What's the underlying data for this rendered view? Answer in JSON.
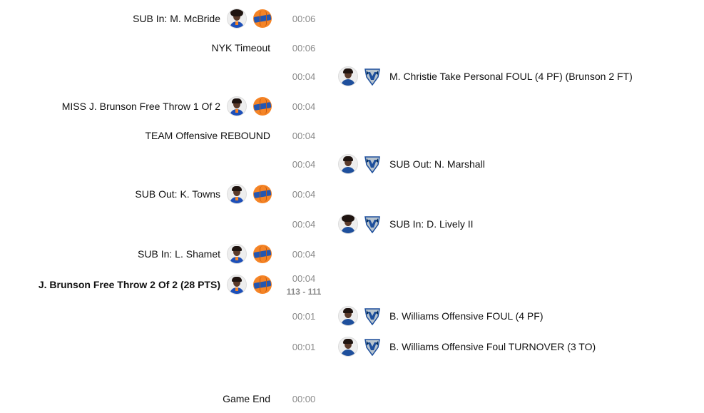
{
  "events": [
    {
      "side": "left",
      "text": "SUB In: M. McBride",
      "time": "00:06",
      "team": "nyk",
      "bold": false,
      "icons": true
    },
    {
      "side": "left",
      "text": "NYK Timeout",
      "time": "00:06",
      "team": "nyk",
      "bold": false,
      "icons": false
    },
    {
      "side": "right",
      "text": "M. Christie Take Personal FOUL (4 PF) (Brunson 2 FT)",
      "time": "00:04",
      "team": "dal",
      "bold": false,
      "icons": true
    },
    {
      "side": "left",
      "text": "MISS J. Brunson Free Throw 1 Of 2",
      "time": "00:04",
      "team": "nyk",
      "bold": false,
      "icons": true
    },
    {
      "side": "left",
      "text": "TEAM Offensive REBOUND",
      "time": "00:04",
      "team": "nyk",
      "bold": false,
      "icons": false
    },
    {
      "side": "right",
      "text": "SUB Out: N. Marshall",
      "time": "00:04",
      "team": "dal",
      "bold": false,
      "icons": true
    },
    {
      "side": "left",
      "text": "SUB Out: K. Towns",
      "time": "00:04",
      "team": "nyk",
      "bold": false,
      "icons": true
    },
    {
      "side": "right",
      "text": "SUB In: D. Lively II",
      "time": "00:04",
      "team": "dal",
      "bold": false,
      "icons": true
    },
    {
      "side": "left",
      "text": "SUB In: L. Shamet",
      "time": "00:04",
      "team": "nyk",
      "bold": false,
      "icons": true
    },
    {
      "side": "left",
      "text": "J. Brunson Free Throw 2 Of 2 (28 PTS)",
      "time": "00:04",
      "score": "113 - 111",
      "team": "nyk",
      "bold": true,
      "icons": true
    },
    {
      "side": "right",
      "text": "B. Williams Offensive FOUL (4 PF)",
      "time": "00:01",
      "team": "dal",
      "bold": false,
      "icons": true
    },
    {
      "side": "right",
      "text": "B. Williams Offensive Foul TURNOVER (3 TO)",
      "time": "00:01",
      "team": "dal",
      "bold": false,
      "icons": true
    },
    {
      "side": "left",
      "text": "Game End",
      "time": "00:00",
      "team": "",
      "bold": false,
      "icons": false
    }
  ],
  "icons": {
    "player_headshot": "player-headshot-icon",
    "nyk_logo": "knicks-logo-icon",
    "dal_logo": "mavericks-logo-icon"
  },
  "colors": {
    "time": "#8a8a8a",
    "text": "#111111",
    "nyk_orange": "#f58426",
    "nyk_blue": "#2356b2",
    "dal_blue": "#1e4f9c"
  }
}
